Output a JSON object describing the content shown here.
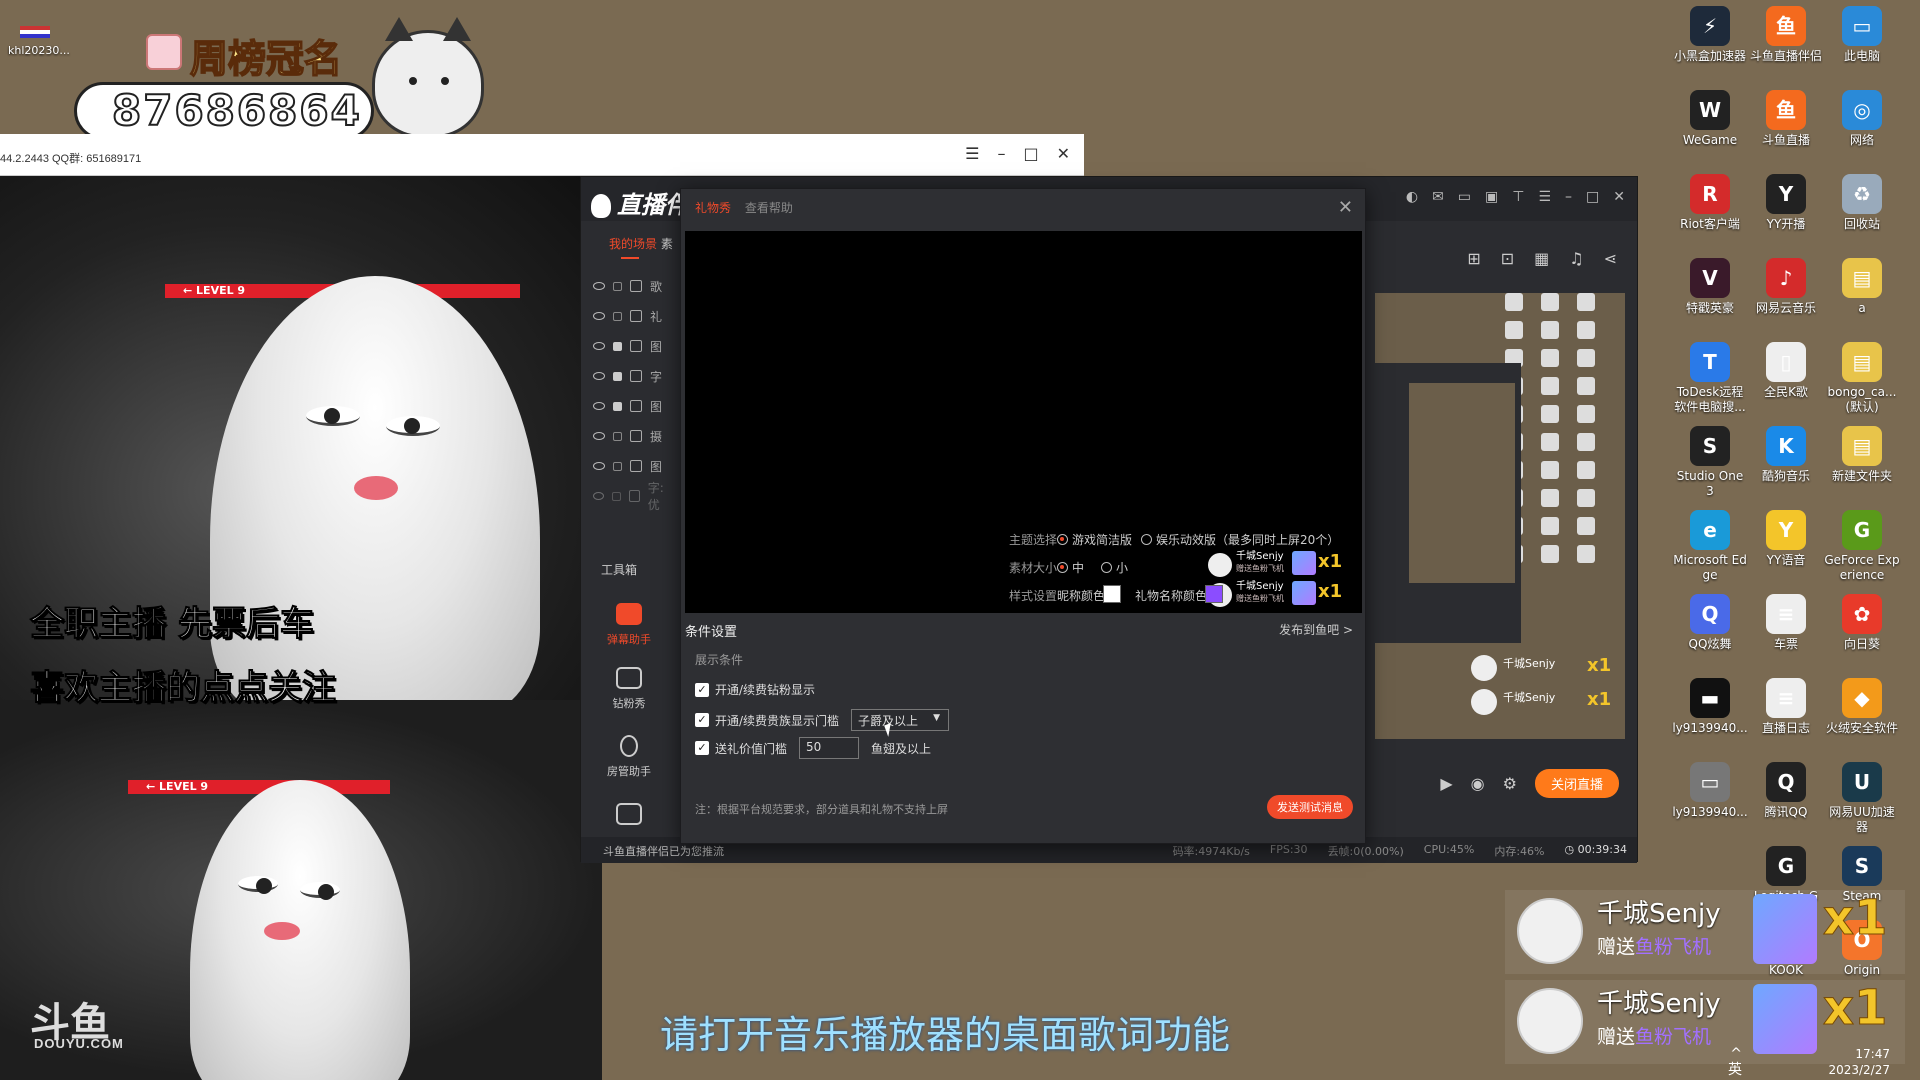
{
  "top_overlay": {
    "user": "khl20230...",
    "banner": "周榜冠名",
    "qq_number": "87686864"
  },
  "qq_window": {
    "info": "44.2.2443  QQ群: 651689171"
  },
  "stream": {
    "level_text": "← LEVEL 9",
    "line1": "全职主播 先票后车",
    "line2": "喜欢主播的点点关注",
    "logo": "斗鱼",
    "logo_sub": "DOUYU.COM"
  },
  "app": {
    "title": "直播伴侣",
    "scene_tabs": "我的场景",
    "scene_tab_second": "素",
    "scenes": [
      {
        "label": "歌",
        "locked": false
      },
      {
        "label": "礼",
        "locked": false
      },
      {
        "label": "图",
        "locked": true
      },
      {
        "label": "字",
        "locked": true
      },
      {
        "label": "图",
        "locked": true
      },
      {
        "label": "摄",
        "locked": false
      },
      {
        "label": "图",
        "locked": false
      },
      {
        "label": "字: 优",
        "locked": false
      }
    ],
    "toolbox": "工具箱",
    "tools": [
      "弹幕助手",
      "钻粉秀",
      "房管助手"
    ],
    "close_live": "关闭直播",
    "status_left": "斗鱼直播伴侣已为您推流",
    "status": {
      "bitrate": "码率:4974Kb/s",
      "fps": "FPS:30",
      "drop": "丢帧:0(0.00%)",
      "cpu": "CPU:45%",
      "mem": "内存:46%",
      "time": "00:39:34"
    },
    "mini_gifts": [
      {
        "name": "千城Senjy",
        "count": "x1"
      },
      {
        "name": "千城Senjy",
        "count": "x1"
      }
    ]
  },
  "dialog": {
    "tab_active": "礼物秀",
    "tab_help": "查看帮助",
    "preview_gifts": [
      {
        "name": "千城Senjy",
        "sub": "赠送鱼粉飞机",
        "count": "x1"
      },
      {
        "name": "千城Senjy",
        "sub": "赠送鱼粉飞机",
        "count": "x1"
      }
    ],
    "cond_title": "条件设置",
    "publish": "发布到鱼吧 >",
    "show_cond": "展示条件",
    "check1": "开通/续费钻粉显示",
    "check2": "开通/续费贵族显示门槛",
    "check2_select": "子爵及以上",
    "check3": "送礼价值门槛",
    "check3_value": "50",
    "check3_unit": "鱼翅及以上",
    "theme_label": "主题选择",
    "theme_opt1": "游戏简洁版",
    "theme_opt2": "娱乐动效版（最多同时上屏20个）",
    "size_label": "素材大小",
    "size_opt1": "中",
    "size_opt2": "小",
    "style_label": "样式设置",
    "nick_color_label": "昵称颜色",
    "gift_color_label": "礼物名称颜色",
    "nick_color": "#ffffff",
    "gift_color": "#8b4dff",
    "note": "注：根据平台规范要求，部分道具和礼物不支持上屏",
    "send_test": "发送测试消息"
  },
  "desktop_icons": [
    {
      "label": "小黑盒加速器",
      "icon": "game-booster-icon",
      "color": "#1e2a3a",
      "glyph": "⚡"
    },
    {
      "label": "斗鱼直播伴侣",
      "icon": "douyu-companion-icon",
      "color": "#f46a1e",
      "glyph": "鱼"
    },
    {
      "label": "此电脑",
      "icon": "computer-icon",
      "color": "#2a8ad8",
      "glyph": "▭"
    },
    {
      "label": "WeGame",
      "icon": "wegame-icon",
      "color": "#222",
      "glyph": "W"
    },
    {
      "label": "斗鱼直播",
      "icon": "douyu-icon",
      "color": "#f46a1e",
      "glyph": "鱼"
    },
    {
      "label": "网络",
      "icon": "network-icon",
      "color": "#2a8ad8",
      "glyph": "◎"
    },
    {
      "label": "Riot客户端",
      "icon": "riot-icon",
      "color": "#d42b2b",
      "glyph": "R"
    },
    {
      "label": "YY开播",
      "icon": "yy-live-icon",
      "color": "#222",
      "glyph": "Y"
    },
    {
      "label": "回收站",
      "icon": "recycle-bin-icon",
      "color": "#9ab",
      "glyph": "♻"
    },
    {
      "label": "特戳英豪",
      "icon": "valorant-icon",
      "color": "#3a1a2a",
      "glyph": "V"
    },
    {
      "label": "网易云音乐",
      "icon": "netease-music-icon",
      "color": "#d42b2b",
      "glyph": "♪"
    },
    {
      "label": "a",
      "icon": "folder-icon",
      "color": "#e8c44a",
      "glyph": "▤"
    },
    {
      "label": "ToDesk远程软件电脑搜...",
      "icon": "todesk-icon",
      "color": "#2a7ae8",
      "glyph": "T"
    },
    {
      "label": "全民K歌",
      "icon": "file-icon",
      "color": "#eee",
      "glyph": "▯"
    },
    {
      "label": "bongo_ca...(默认)",
      "icon": "folder-icon",
      "color": "#e8c44a",
      "glyph": "▤"
    },
    {
      "label": "Studio One 3",
      "icon": "studio-one-icon",
      "color": "#222",
      "glyph": "S"
    },
    {
      "label": "酷狗音乐",
      "icon": "kugou-icon",
      "color": "#1a8ae8",
      "glyph": "K"
    },
    {
      "label": "新建文件夹",
      "icon": "folder-icon",
      "color": "#e8c44a",
      "glyph": "▤"
    },
    {
      "label": "Microsoft Edge",
      "icon": "edge-icon",
      "color": "#1a9ad8",
      "glyph": "e"
    },
    {
      "label": "YY语音",
      "icon": "yy-voice-icon",
      "color": "#f3c52a",
      "glyph": "Y"
    },
    {
      "label": "GeForce Experience",
      "icon": "geforce-icon",
      "color": "#5a9a1a",
      "glyph": "G"
    },
    {
      "label": "QQ炫舞",
      "icon": "qq-dance-icon",
      "color": "#4a6ae8",
      "glyph": "Q"
    },
    {
      "label": "车票",
      "icon": "text-file-icon",
      "color": "#eee",
      "glyph": "≡"
    },
    {
      "label": "向日葵",
      "icon": "sunflower-icon",
      "color": "#e83a2a",
      "glyph": "✿"
    },
    {
      "label": "ly9139940...",
      "icon": "file-icon",
      "color": "#111",
      "glyph": "▬"
    },
    {
      "label": "直播日志",
      "icon": "text-file-icon",
      "color": "#eee",
      "glyph": "≡"
    },
    {
      "label": "火绒安全软件",
      "icon": "huorong-icon",
      "color": "#f39a1a",
      "glyph": "◆"
    },
    {
      "label": "ly9139940...",
      "icon": "file-icon",
      "color": "#777",
      "glyph": "▭"
    },
    {
      "label": "腾讯QQ",
      "icon": "qq-icon",
      "color": "#222",
      "glyph": "Q"
    },
    {
      "label": "网易UU加速器",
      "icon": "uu-booster-icon",
      "color": "#1a3a4a",
      "glyph": "U"
    },
    {
      "label": "Logitech G",
      "icon": "logitech-icon",
      "color": "#222",
      "glyph": "G"
    },
    {
      "label": "Steam",
      "icon": "steam-icon",
      "color": "#1a3a5a",
      "glyph": "S"
    },
    {
      "label": "KOOK",
      "icon": "kook-icon",
      "color": "#2a2a2a",
      "glyph": "K"
    },
    {
      "label": "Origin",
      "icon": "origin-icon",
      "color": "#f36a1a",
      "glyph": "O"
    }
  ],
  "big_gifts": [
    {
      "name": "千城Senjy",
      "action": "赠送",
      "gift": "鱼粉飞机",
      "count": "x1"
    },
    {
      "name": "千城Senjy",
      "action": "赠送",
      "gift": "鱼粉飞机",
      "count": "x1"
    }
  ],
  "lyric": "请打开音乐播放器的桌面歌词功能",
  "taskbar": {
    "ime": "^ 英",
    "time": "17:47",
    "date": "2023/2/27"
  }
}
